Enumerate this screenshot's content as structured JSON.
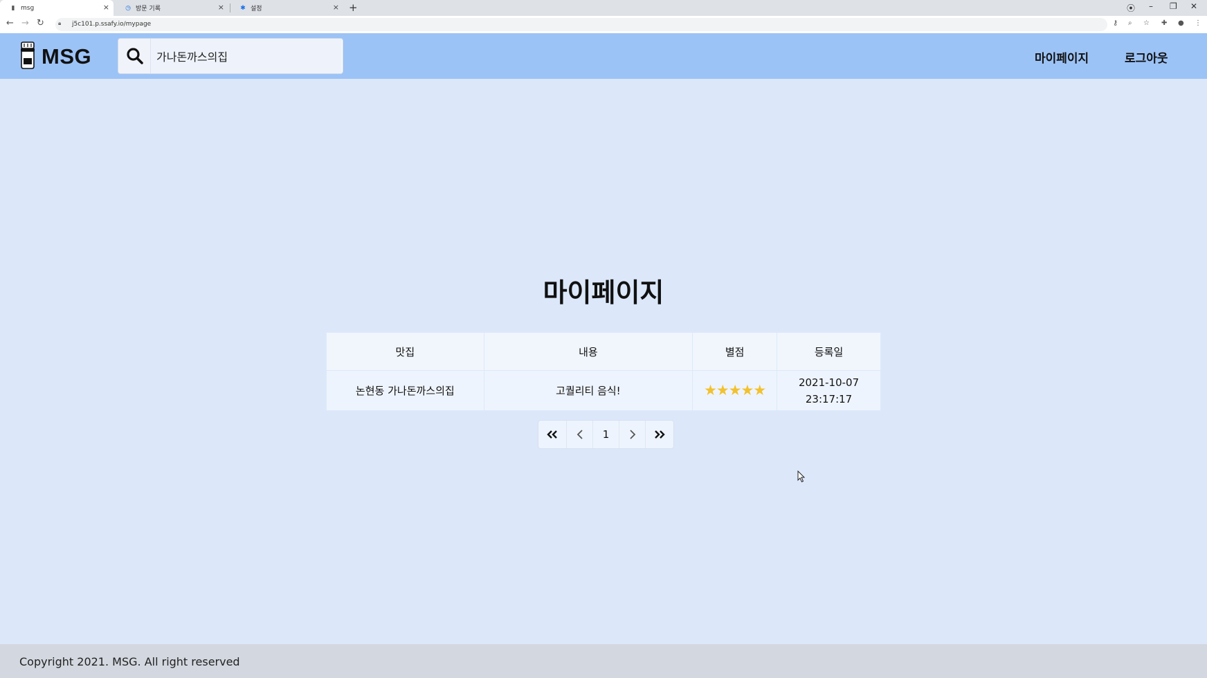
{
  "browser": {
    "tabs": [
      {
        "title": "msg",
        "icon": "trashcan-icon",
        "active": true
      },
      {
        "title": "방문 기록",
        "icon": "history-icon",
        "active": false
      },
      {
        "title": "설정",
        "icon": "gear-icon",
        "active": false
      }
    ],
    "url": "j5c101.p.ssafy.io/mypage"
  },
  "header": {
    "logo_text": "MSG",
    "search_value": "가나돈까스의집",
    "nav": {
      "mypage": "마이페이지",
      "logout": "로그아웃"
    }
  },
  "main": {
    "title": "마이페이지",
    "table": {
      "headers": [
        "맛집",
        "내용",
        "별점",
        "등록일"
      ],
      "rows": [
        {
          "restaurant": "논현동 가나돈까스의집",
          "content": "고퀄리티 음식!",
          "stars": "★★★★★",
          "rating": 5,
          "date": "2021-10-07",
          "time": "23:17:17"
        }
      ]
    },
    "pagination": {
      "first": "«",
      "prev": "‹",
      "current": "1",
      "next": "›",
      "last": "»"
    }
  },
  "footer": {
    "copyright": "Copyright 2021. MSG. All right reserved"
  },
  "colors": {
    "header_bg": "#9cc3f6",
    "page_bg": "#dce8fa",
    "star": "#f2c12e",
    "footer_bg": "#d3d7df"
  }
}
